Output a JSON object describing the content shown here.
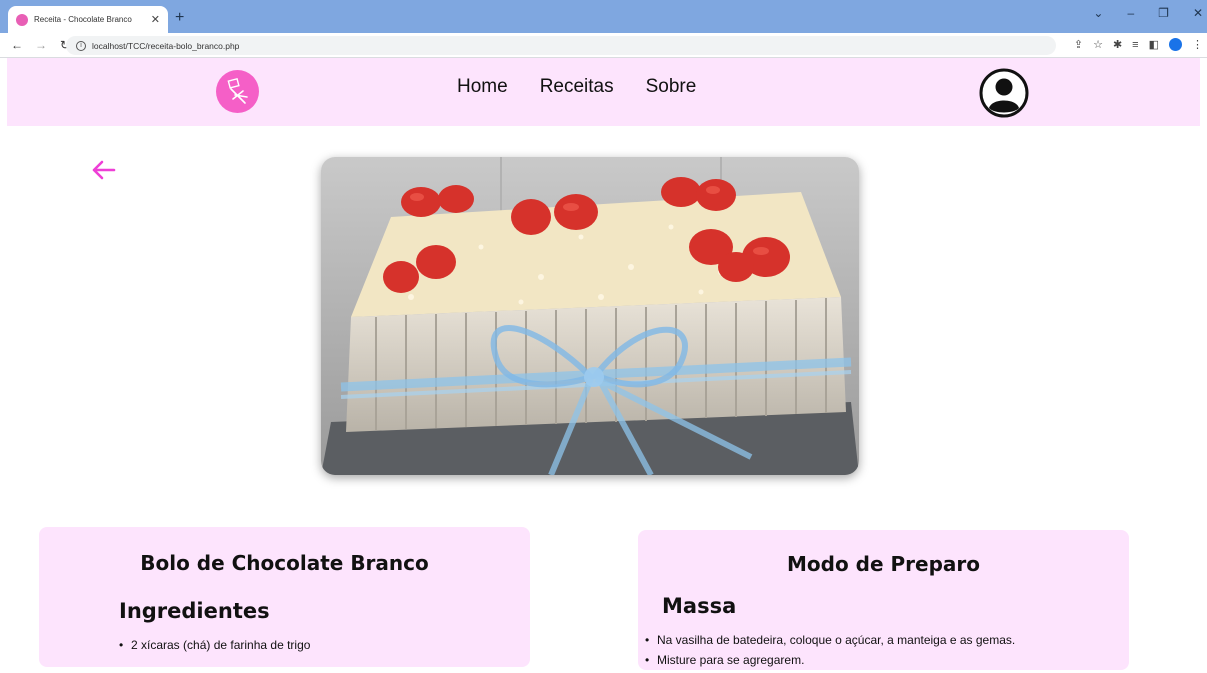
{
  "browser": {
    "tab_title": "Receita - Chocolate Branco",
    "url": "localhost/TCC/receita-bolo_branco.php"
  },
  "site": {
    "nav": [
      "Home",
      "Receitas",
      "Sobre"
    ]
  },
  "recipe": {
    "title": "Bolo de Chocolate Branco",
    "ingredients_heading": "Ingredientes",
    "ingredients": [
      "2 xícaras (chá) de farinha de trigo"
    ]
  },
  "preparation": {
    "title": "Modo de Preparo",
    "section_heading": "Massa",
    "steps": [
      "Na vasilha de batedeira, coloque o açúcar, a manteiga e as gemas.",
      "Misture para se agregarem."
    ]
  },
  "colors": {
    "header_bg": "#fde4fd",
    "accent": "#f55fc7",
    "back_arrow": "#ee3fd6"
  },
  "icons": {
    "back": "arrow-left-icon",
    "account": "user-circle-icon",
    "logo": "logo-icon"
  }
}
